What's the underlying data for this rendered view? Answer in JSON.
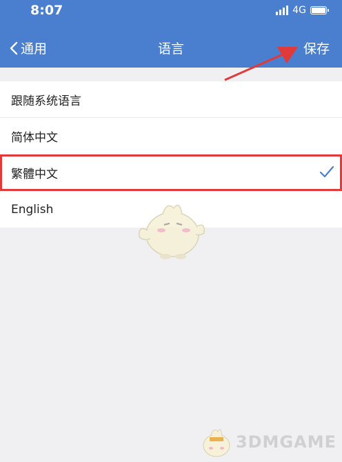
{
  "status_bar": {
    "time": "8:07",
    "network": "4G"
  },
  "nav": {
    "back_label": "通用",
    "title": "语言",
    "save_label": "保存"
  },
  "languages": [
    {
      "label": "跟随系统语言",
      "selected": false
    },
    {
      "label": "简体中文",
      "selected": false
    },
    {
      "label": "繁體中文",
      "selected": true
    },
    {
      "label": "English",
      "selected": false
    }
  ],
  "colors": {
    "header": "#4a7fd0",
    "check": "#4a7fd0",
    "annotation": "#e03a3a"
  },
  "watermark": {
    "text": "3DMGAME"
  }
}
